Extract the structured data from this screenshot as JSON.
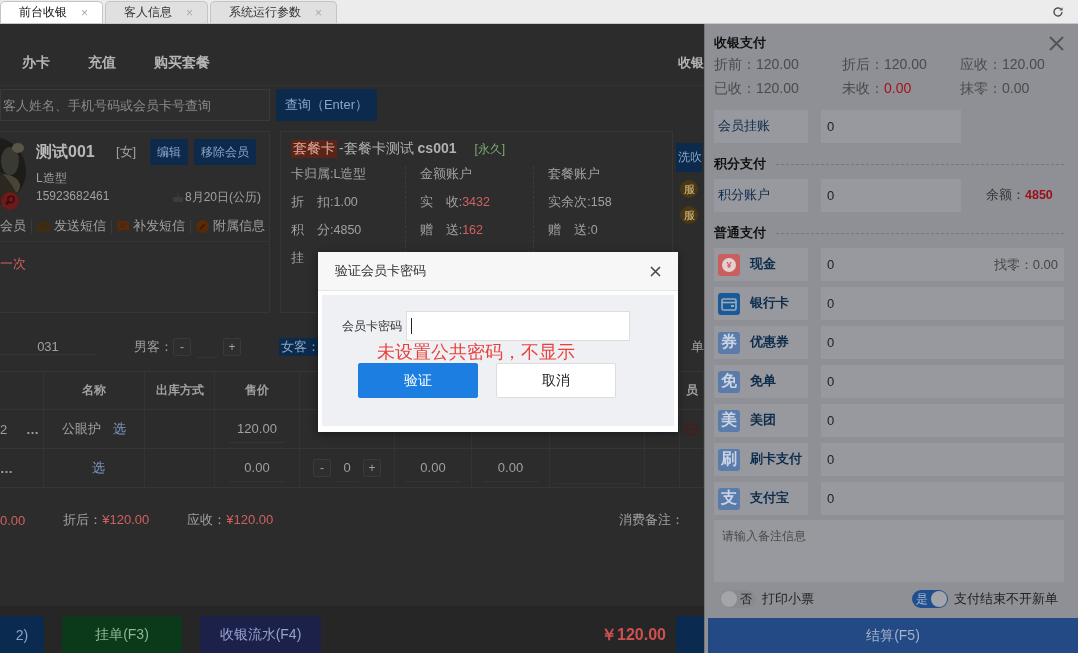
{
  "tabs": [
    {
      "label": "前台收银",
      "close": "×",
      "selected": true
    },
    {
      "label": "客人信息",
      "close": "×",
      "selected": false
    },
    {
      "label": "系统运行参数",
      "close": "×",
      "selected": false
    }
  ],
  "top_nav": [
    "办卡",
    "充值",
    "购买套餐",
    "收银"
  ],
  "search": {
    "placeholder": "客人姓名、手机号码或会员卡号查询",
    "button": "查询（Enter）"
  },
  "member": {
    "name": "测试001",
    "gender": "[女]",
    "buttons": [
      "编辑",
      "移除会员"
    ],
    "shop": "L造型",
    "phone": "15923682461",
    "birthday": "8月20日(公历)",
    "links": [
      "会员",
      "发送短信",
      "补发短信",
      "附属信息"
    ],
    "note": "一次"
  },
  "card": {
    "badge": "套餐卡",
    "title": "-套餐卡测试 **cs001**",
    "term": "[永久]",
    "columns": [
      {
        "rows": [
          {
            "label": "卡归属:",
            "value": "L造型",
            "emphasis": false
          },
          {
            "label": "折　扣:",
            "value": "1.00",
            "emphasis": false
          },
          {
            "label": "积　分:",
            "value": "4850",
            "emphasis": false
          },
          {
            "label": "挂"
          }
        ]
      },
      {
        "heading": "金额账户",
        "rows": [
          {
            "label": "实　收:",
            "value": "3432",
            "emphasis": true
          },
          {
            "label": "赠　送:",
            "value": "162",
            "emphasis": true
          }
        ]
      },
      {
        "heading": "套餐账户",
        "rows": [
          {
            "label": "实余次:",
            "value": "158",
            "emphasis": false
          },
          {
            "label": "赠　送:",
            "value": "0",
            "emphasis": false
          }
        ]
      }
    ]
  },
  "side_tab": {
    "label": "洗吹",
    "badges": [
      "服",
      "服"
    ]
  },
  "guests": {
    "number": "031",
    "male_label": "男客：",
    "minus": "-",
    "plus": "+",
    "female_label": "女客：",
    "unit_label": "单"
  },
  "table": {
    "columns": [
      {
        "label": "名称"
      },
      {
        "label": "出库方式"
      },
      {
        "label": "售价"
      },
      {
        "label": "员"
      }
    ],
    "rows": [
      {
        "kind": "item",
        "index": "2",
        "more": "…",
        "name": "公眼护",
        "pick": "选",
        "price": "120.00"
      },
      {
        "kind": "new",
        "more": "…",
        "pick": "选",
        "price": "0.00",
        "qty": {
          "minus": "-",
          "value": "0",
          "plus": "+"
        },
        "amount_1": "0.00",
        "amount_2": "0.00"
      }
    ]
  },
  "totals": {
    "before": "0.00",
    "after_label": "折后：",
    "after": "¥120.00",
    "due_label": "应收：",
    "due": "¥120.00",
    "remark_label": "消费备注："
  },
  "bottom": {
    "buttons": [
      "2)",
      "挂单(F3)",
      "收银流水(F4)"
    ],
    "total": "￥120.00"
  },
  "payment": {
    "title": "收银支付",
    "summary": [
      {
        "label": "折前：",
        "value": "120.00",
        "alert": false
      },
      {
        "label": "折后：",
        "value": "120.00",
        "alert": false
      },
      {
        "label": "应收：",
        "value": "120.00",
        "alert": false
      },
      {
        "label": "已收：",
        "value": "120.00",
        "alert": false
      },
      {
        "label": "未收：",
        "value": "0.00",
        "alert": true
      },
      {
        "label": "抹零：",
        "value": "0.00",
        "alert": false
      }
    ],
    "member_credit": {
      "label": "会员挂账",
      "value": "0"
    },
    "points": {
      "heading": "积分支付",
      "label": "积分账户",
      "value": "0",
      "balance_label": "余额：",
      "balance": "4850"
    },
    "general": {
      "heading": "普通支付",
      "methods": [
        {
          "kind": "cash",
          "glyph": "¥",
          "label": "现金",
          "value": "0",
          "change": "找零：0.00"
        },
        {
          "kind": "card",
          "label": "银行卡",
          "value": "0"
        },
        {
          "kind": "glyph",
          "glyph": "券",
          "label": "优惠券",
          "value": "0"
        },
        {
          "kind": "glyph",
          "glyph": "免",
          "label": "免单",
          "value": "0"
        },
        {
          "kind": "glyph",
          "glyph": "美",
          "label": "美团",
          "value": "0"
        },
        {
          "kind": "glyph",
          "glyph": "刷",
          "label": "刷卡支付",
          "value": "0"
        },
        {
          "kind": "glyph",
          "glyph": "支",
          "label": "支付宝",
          "value": "0"
        }
      ]
    },
    "note_placeholder": "请输入备注信息",
    "toggles": [
      {
        "state_label": "否",
        "label": "打印小票",
        "on": false
      },
      {
        "state_label": "是",
        "label": "支付结束不开新单",
        "on": true
      }
    ],
    "submit": "结算(F5)"
  },
  "dialog": {
    "title": "验证会员卡密码",
    "field_label": "会员卡密码",
    "annotation": "未设置公共密码，不显示",
    "buttons": [
      {
        "label": "验证",
        "primary": true
      },
      {
        "label": "取消",
        "primary": false
      }
    ]
  }
}
